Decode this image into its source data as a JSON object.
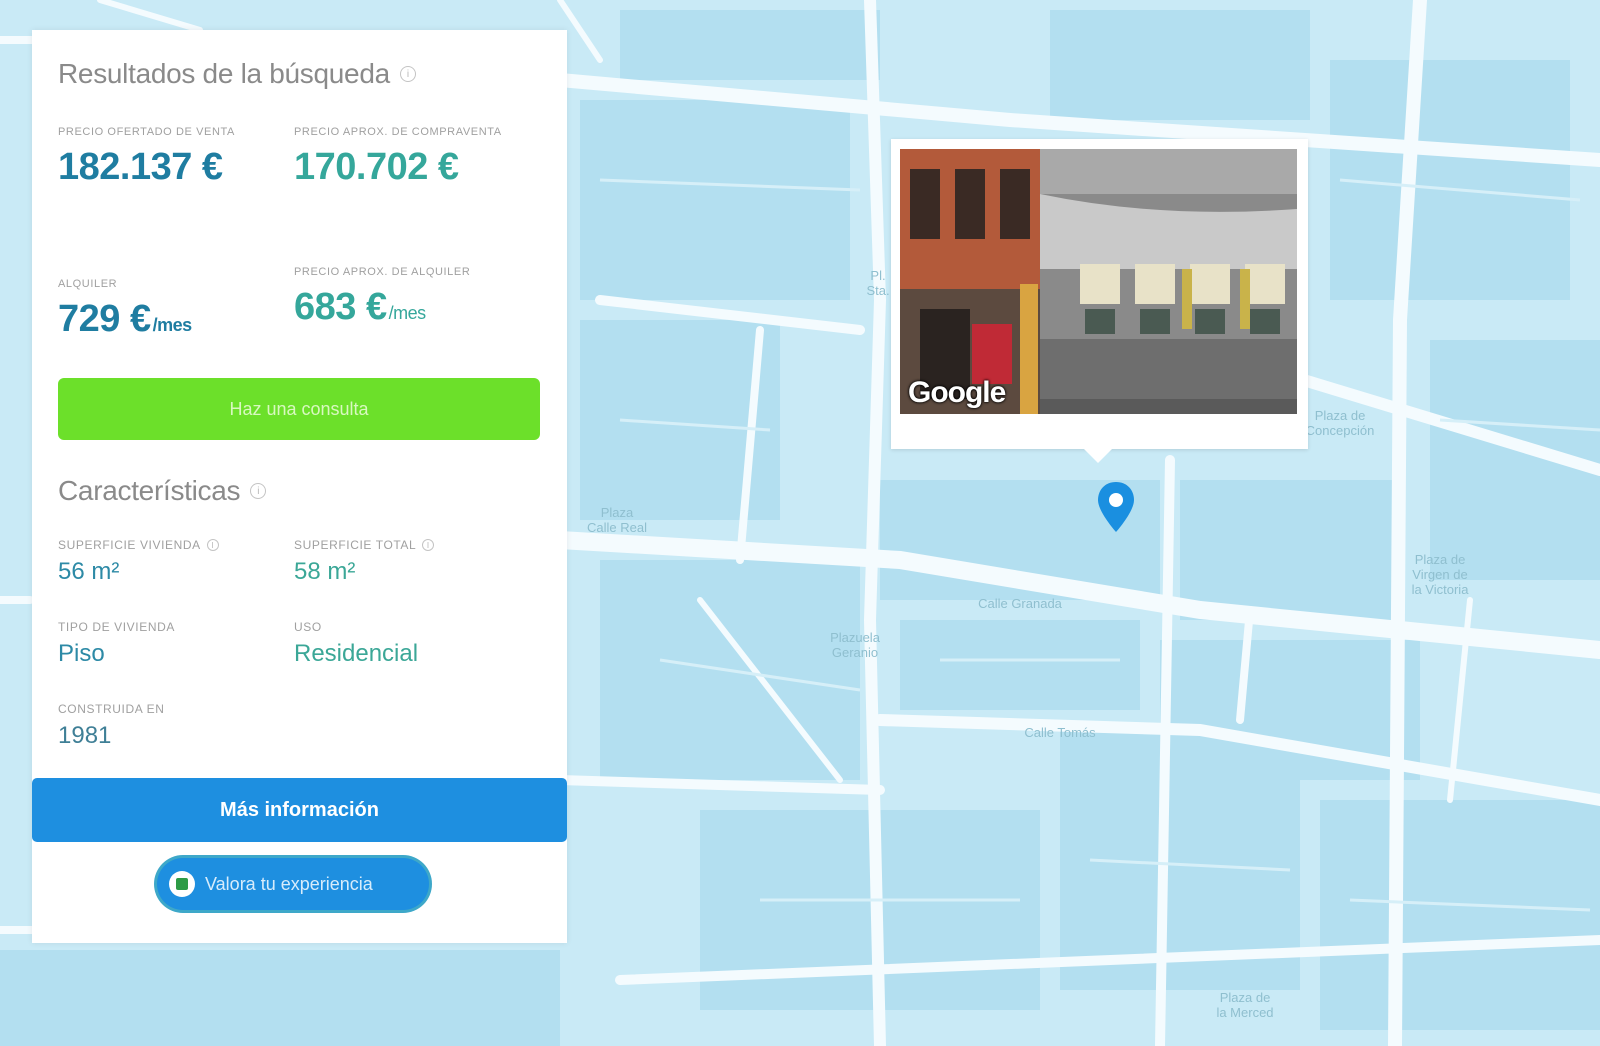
{
  "results": {
    "title": "Resultados de la búsqueda",
    "info_glyph": "i",
    "offer_sale_label": "PRECIO OFERTADO DE VENTA",
    "offer_sale_value": "182.137 €",
    "appraisal_sale_label": "PRECIO APROX. DE COMPRAVENTA",
    "appraisal_sale_value": "170.702 €",
    "rent_label": "ALQUILER",
    "rent_value": "729 €",
    "rent_unit": "/mes",
    "appraisal_rent_label": "PRECIO APROX. DE ALQUILER",
    "appraisal_rent_value": "683 €",
    "appraisal_rent_unit": "/mes",
    "cta_label": "Haz una consulta"
  },
  "features": {
    "title": "Características",
    "info_glyph": "i",
    "living_area_label": "SUPERFICIE VIVIENDA",
    "living_area_value": "56 m²",
    "total_area_label": "SUPERFICIE TOTAL",
    "total_area_value": "58 m²",
    "type_label": "TIPO DE VIVIENDA",
    "type_value": "Piso",
    "use_label": "USO",
    "use_value": "Residencial",
    "built_label": "CONSTRUIDA EN",
    "built_value": "1981"
  },
  "more_info_button": "Más información",
  "share_button": {
    "label": "Valora tu experiencia",
    "icon": "feedback-icon"
  },
  "popup": {
    "watermark": "Google"
  },
  "map": {
    "labels": [
      "Pl. Sta.",
      "Plaza\nCalle Real",
      "Plaza de\nVirgen de\nla Victoria",
      "Plazuela\nGeranio",
      "Calle Granada",
      "Calle Tomás",
      "Plaza de\nConcepción",
      "Plaza de\nla Merced"
    ],
    "pin_icon": "location-pin-icon",
    "colors": {
      "water_bg": "#c9eaf6",
      "block": "#b3dff0",
      "road": "#f4fbfe",
      "pin": "#1a8fe0"
    }
  },
  "colors": {
    "price_blue": "#1f7da1",
    "price_teal": "#35a79b",
    "green_button": "#6ce02a",
    "blue_button": "#1e8fe0"
  }
}
